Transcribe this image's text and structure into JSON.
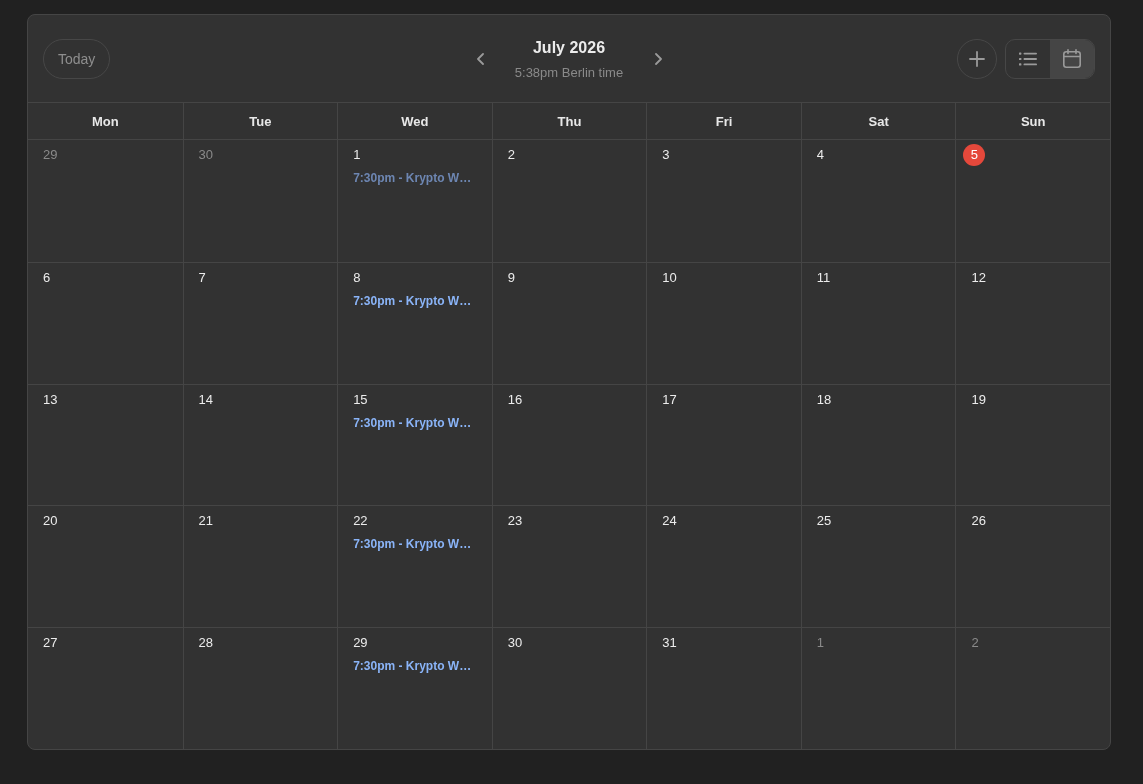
{
  "header": {
    "today_button": "Today",
    "title": "July 2026",
    "subtitle": "5:38pm Berlin time",
    "view_options": [
      {
        "kind": "list",
        "selected": false
      },
      {
        "kind": "month",
        "selected": true
      }
    ]
  },
  "weekdays": [
    "Mon",
    "Tue",
    "Wed",
    "Thu",
    "Fri",
    "Sat",
    "Sun"
  ],
  "weeks": [
    [
      {
        "day": "29",
        "outside": true,
        "today": false
      },
      {
        "day": "30",
        "outside": true,
        "today": false
      },
      {
        "day": "1",
        "outside": false,
        "today": false,
        "events": [
          {
            "label": "7:30pm - Krypto W…",
            "past": true
          }
        ]
      },
      {
        "day": "2",
        "outside": false,
        "today": false
      },
      {
        "day": "3",
        "outside": false,
        "today": false
      },
      {
        "day": "4",
        "outside": false,
        "today": false
      },
      {
        "day": "5",
        "outside": false,
        "today": true
      }
    ],
    [
      {
        "day": "6",
        "outside": false,
        "today": false
      },
      {
        "day": "7",
        "outside": false,
        "today": false
      },
      {
        "day": "8",
        "outside": false,
        "today": false,
        "events": [
          {
            "label": "7:30pm - Krypto W…",
            "past": false
          }
        ]
      },
      {
        "day": "9",
        "outside": false,
        "today": false
      },
      {
        "day": "10",
        "outside": false,
        "today": false
      },
      {
        "day": "11",
        "outside": false,
        "today": false
      },
      {
        "day": "12",
        "outside": false,
        "today": false
      }
    ],
    [
      {
        "day": "13",
        "outside": false,
        "today": false
      },
      {
        "day": "14",
        "outside": false,
        "today": false
      },
      {
        "day": "15",
        "outside": false,
        "today": false,
        "events": [
          {
            "label": "7:30pm - Krypto W…",
            "past": false
          }
        ]
      },
      {
        "day": "16",
        "outside": false,
        "today": false
      },
      {
        "day": "17",
        "outside": false,
        "today": false
      },
      {
        "day": "18",
        "outside": false,
        "today": false
      },
      {
        "day": "19",
        "outside": false,
        "today": false
      }
    ],
    [
      {
        "day": "20",
        "outside": false,
        "today": false
      },
      {
        "day": "21",
        "outside": false,
        "today": false
      },
      {
        "day": "22",
        "outside": false,
        "today": false,
        "events": [
          {
            "label": "7:30pm - Krypto W…",
            "past": false
          }
        ]
      },
      {
        "day": "23",
        "outside": false,
        "today": false
      },
      {
        "day": "24",
        "outside": false,
        "today": false
      },
      {
        "day": "25",
        "outside": false,
        "today": false
      },
      {
        "day": "26",
        "outside": false,
        "today": false
      }
    ],
    [
      {
        "day": "27",
        "outside": false,
        "today": false
      },
      {
        "day": "28",
        "outside": false,
        "today": false
      },
      {
        "day": "29",
        "outside": false,
        "today": false,
        "events": [
          {
            "label": "7:30pm - Krypto W…",
            "past": false
          }
        ]
      },
      {
        "day": "30",
        "outside": false,
        "today": false
      },
      {
        "day": "31",
        "outside": false,
        "today": false
      },
      {
        "day": "1",
        "outside": true,
        "today": false
      },
      {
        "day": "2",
        "outside": true,
        "today": false
      }
    ]
  ]
}
